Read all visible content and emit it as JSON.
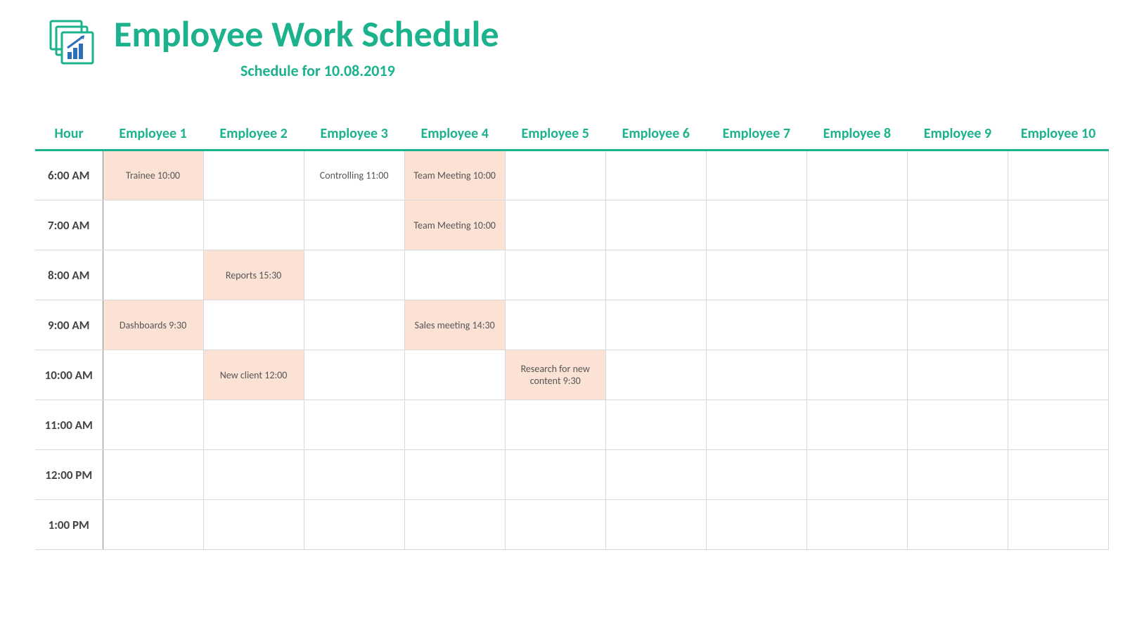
{
  "header": {
    "title": "Employee Work Schedule",
    "subtitle": "Schedule for 10.08.2019"
  },
  "columns": {
    "hour": "Hour",
    "employees": [
      "Employee 1",
      "Employee 2",
      "Employee 3",
      "Employee 4",
      "Employee 5",
      "Employee 6",
      "Employee 7",
      "Employee 8",
      "Employee 9",
      "Employee 10"
    ]
  },
  "rows": [
    {
      "hour": "6:00 AM",
      "cells": [
        {
          "text": "Trainee 10:00",
          "fill": true
        },
        {
          "text": "",
          "fill": false
        },
        {
          "text": "Controlling 11:00",
          "fill": false
        },
        {
          "text": "Team Meeting 10:00",
          "fill": true
        },
        {
          "text": "",
          "fill": false
        },
        {
          "text": "",
          "fill": false
        },
        {
          "text": "",
          "fill": false
        },
        {
          "text": "",
          "fill": false
        },
        {
          "text": "",
          "fill": false
        },
        {
          "text": "",
          "fill": false
        }
      ]
    },
    {
      "hour": "7:00 AM",
      "cells": [
        {
          "text": "",
          "fill": false
        },
        {
          "text": "",
          "fill": false
        },
        {
          "text": "",
          "fill": false
        },
        {
          "text": "Team Meeting 10:00",
          "fill": true
        },
        {
          "text": "",
          "fill": false
        },
        {
          "text": "",
          "fill": false
        },
        {
          "text": "",
          "fill": false
        },
        {
          "text": "",
          "fill": false
        },
        {
          "text": "",
          "fill": false
        },
        {
          "text": "",
          "fill": false
        }
      ]
    },
    {
      "hour": "8:00 AM",
      "cells": [
        {
          "text": "",
          "fill": false
        },
        {
          "text": "Reports 15:30",
          "fill": true
        },
        {
          "text": "",
          "fill": false
        },
        {
          "text": "",
          "fill": false
        },
        {
          "text": "",
          "fill": false
        },
        {
          "text": "",
          "fill": false
        },
        {
          "text": "",
          "fill": false
        },
        {
          "text": "",
          "fill": false
        },
        {
          "text": "",
          "fill": false
        },
        {
          "text": "",
          "fill": false
        }
      ]
    },
    {
      "hour": "9:00 AM",
      "cells": [
        {
          "text": "Dashboards 9:30",
          "fill": true
        },
        {
          "text": "",
          "fill": false
        },
        {
          "text": "",
          "fill": false
        },
        {
          "text": "Sales meeting 14:30",
          "fill": true
        },
        {
          "text": "",
          "fill": false
        },
        {
          "text": "",
          "fill": false
        },
        {
          "text": "",
          "fill": false
        },
        {
          "text": "",
          "fill": false
        },
        {
          "text": "",
          "fill": false
        },
        {
          "text": "",
          "fill": false
        }
      ]
    },
    {
      "hour": "10:00 AM",
      "cells": [
        {
          "text": "",
          "fill": false
        },
        {
          "text": "New client 12:00",
          "fill": true
        },
        {
          "text": "",
          "fill": false
        },
        {
          "text": "",
          "fill": false
        },
        {
          "text": "Research for new content 9:30",
          "fill": true
        },
        {
          "text": "",
          "fill": false
        },
        {
          "text": "",
          "fill": false
        },
        {
          "text": "",
          "fill": false
        },
        {
          "text": "",
          "fill": false
        },
        {
          "text": "",
          "fill": false
        }
      ]
    },
    {
      "hour": "11:00 AM",
      "cells": [
        {
          "text": "",
          "fill": false
        },
        {
          "text": "",
          "fill": false
        },
        {
          "text": "",
          "fill": false
        },
        {
          "text": "",
          "fill": false
        },
        {
          "text": "",
          "fill": false
        },
        {
          "text": "",
          "fill": false
        },
        {
          "text": "",
          "fill": false
        },
        {
          "text": "",
          "fill": false
        },
        {
          "text": "",
          "fill": false
        },
        {
          "text": "",
          "fill": false
        }
      ]
    },
    {
      "hour": "12:00 PM",
      "cells": [
        {
          "text": "",
          "fill": false
        },
        {
          "text": "",
          "fill": false
        },
        {
          "text": "",
          "fill": false
        },
        {
          "text": "",
          "fill": false
        },
        {
          "text": "",
          "fill": false
        },
        {
          "text": "",
          "fill": false
        },
        {
          "text": "",
          "fill": false
        },
        {
          "text": "",
          "fill": false
        },
        {
          "text": "",
          "fill": false
        },
        {
          "text": "",
          "fill": false
        }
      ]
    },
    {
      "hour": "1:00 PM",
      "cells": [
        {
          "text": "",
          "fill": false
        },
        {
          "text": "",
          "fill": false
        },
        {
          "text": "",
          "fill": false
        },
        {
          "text": "",
          "fill": false
        },
        {
          "text": "",
          "fill": false
        },
        {
          "text": "",
          "fill": false
        },
        {
          "text": "",
          "fill": false
        },
        {
          "text": "",
          "fill": false
        },
        {
          "text": "",
          "fill": false
        },
        {
          "text": "",
          "fill": false
        }
      ]
    }
  ]
}
